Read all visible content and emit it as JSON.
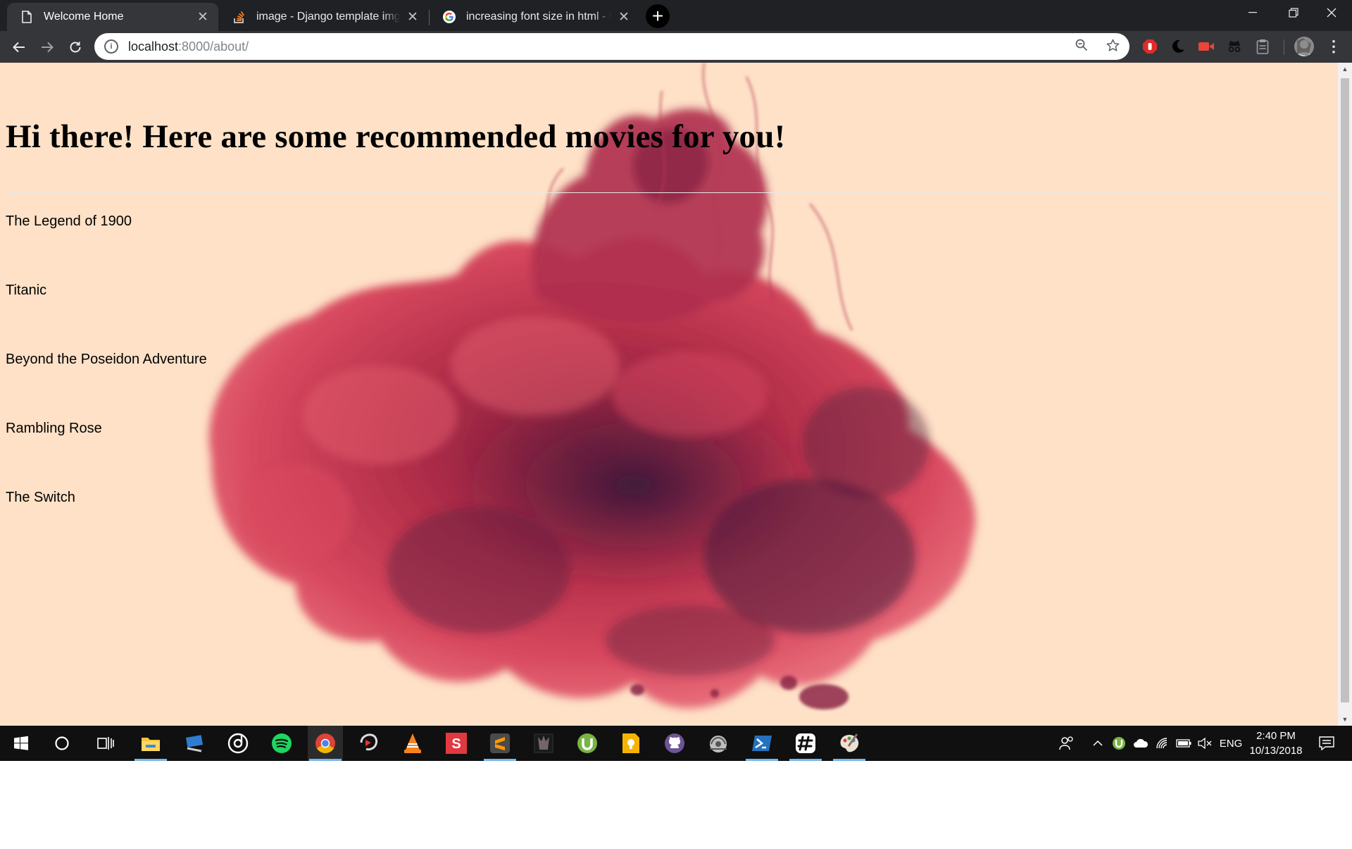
{
  "browser": {
    "tabs": [
      {
        "title": "Welcome Home",
        "active": true,
        "favicon": "document-icon"
      },
      {
        "title": "image - Django template img src",
        "active": false,
        "favicon": "stackoverflow-icon"
      },
      {
        "title": "increasing font size in html - Goo",
        "active": false,
        "favicon": "google-icon"
      }
    ],
    "url_host": "localhost",
    "url_rest": ":8000/about/"
  },
  "page": {
    "heading": "Hi there! Here are some recommended movies for you!",
    "movies": [
      "The Legend of 1900",
      "Titanic",
      "Beyond the Poseidon Adventure",
      "Rambling Rose",
      "The Switch"
    ],
    "background_color": "#fee1c7",
    "ink_color": "#c0344f"
  },
  "taskbar": {
    "apps": [
      "file-explorer-icon",
      "remote-desktop-icon",
      "groove-music-icon",
      "spotify-icon",
      "chrome-icon",
      "razer-icon",
      "vlc-icon",
      "sublime-s-icon",
      "sublime-text-icon",
      "acer-predator-icon",
      "utorrent-icon",
      "keep-icon",
      "github-icon",
      "network-icon",
      "powershell-icon",
      "slack-icon",
      "paint-icon"
    ],
    "language": "ENG",
    "time": "2:40 PM",
    "date": "10/13/2018"
  }
}
